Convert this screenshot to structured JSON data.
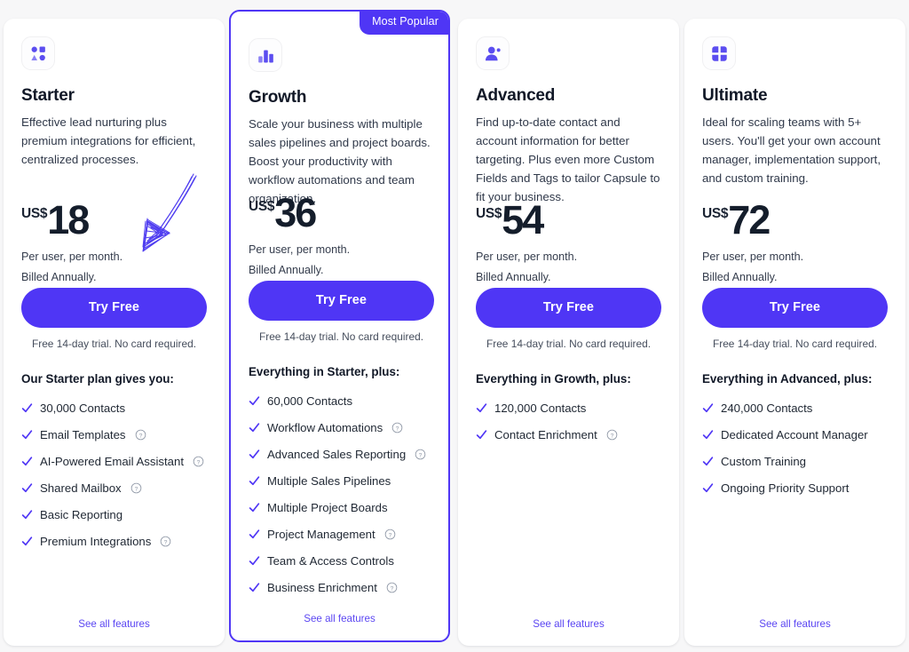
{
  "page": {
    "background": "#f7f7f8",
    "accent": "#4f36f5"
  },
  "annotation": {
    "type": "hand-drawn-arrow",
    "color": "#4f3df0",
    "points_to": "starter-try-free-button"
  },
  "plans": [
    {
      "id": "starter",
      "icon": "shapes-grid-icon",
      "name": "Starter",
      "description": "Effective lead nurturing plus premium integrations for efficient, centralized processes.",
      "badge": null,
      "currency": "US$",
      "price": "18",
      "price_note_1": "Per user, per month.",
      "price_note_2": "Billed Annually.",
      "cta_label": "Try Free",
      "cta_subtext": "Free 14-day trial. No card required.",
      "features_title": "Our Starter plan gives you:",
      "features": [
        {
          "label": "30,000 Contacts",
          "help": false
        },
        {
          "label": "Email Templates",
          "help": true
        },
        {
          "label": "AI-Powered Email Assistant",
          "help": true
        },
        {
          "label": "Shared Mailbox",
          "help": true
        },
        {
          "label": "Basic Reporting",
          "help": false
        },
        {
          "label": "Premium Integrations",
          "help": true
        }
      ],
      "see_all_label": "See all features"
    },
    {
      "id": "growth",
      "icon": "bar-chart-icon",
      "name": "Growth",
      "description": "Scale your business with multiple sales pipelines and project boards. Boost your productivity with workflow automations and team organization.",
      "badge": "Most Popular",
      "currency": "US$",
      "price": "36",
      "price_note_1": "Per user, per month.",
      "price_note_2": "Billed Annually.",
      "cta_label": "Try Free",
      "cta_subtext": "Free 14-day trial. No card required.",
      "features_title": "Everything in Starter, plus:",
      "features": [
        {
          "label": "60,000 Contacts",
          "help": false
        },
        {
          "label": "Workflow Automations",
          "help": true
        },
        {
          "label": "Advanced Sales Reporting",
          "help": true
        },
        {
          "label": "Multiple Sales Pipelines",
          "help": false
        },
        {
          "label": "Multiple Project Boards",
          "help": false
        },
        {
          "label": "Project Management",
          "help": true
        },
        {
          "label": "Team & Access Controls",
          "help": false
        },
        {
          "label": "Business Enrichment",
          "help": true
        }
      ],
      "see_all_label": "See all features"
    },
    {
      "id": "advanced",
      "icon": "user-plus-icon",
      "name": "Advanced",
      "description": "Find up-to-date contact and account information for better targeting. Plus even more Custom Fields and Tags to tailor Capsule to fit your business.",
      "badge": null,
      "currency": "US$",
      "price": "54",
      "price_note_1": "Per user, per month.",
      "price_note_2": "Billed Annually.",
      "cta_label": "Try Free",
      "cta_subtext": "Free 14-day trial. No card required.",
      "features_title": "Everything in Growth, plus:",
      "features": [
        {
          "label": "120,000 Contacts",
          "help": false
        },
        {
          "label": "Contact Enrichment",
          "help": true
        }
      ],
      "see_all_label": "See all features"
    },
    {
      "id": "ultimate",
      "icon": "four-petal-icon",
      "name": "Ultimate",
      "description": "Ideal for scaling teams with 5+ users. You'll get your own account manager, implementation support, and custom training.",
      "badge": null,
      "currency": "US$",
      "price": "72",
      "price_note_1": "Per user, per month.",
      "price_note_2": "Billed Annually.",
      "cta_label": "Try Free",
      "cta_subtext": "Free 14-day trial. No card required.",
      "features_title": "Everything in Advanced, plus:",
      "features": [
        {
          "label": "240,000 Contacts",
          "help": false
        },
        {
          "label": "Dedicated Account Manager",
          "help": false
        },
        {
          "label": "Custom Training",
          "help": false
        },
        {
          "label": "Ongoing Priority Support",
          "help": false
        }
      ],
      "see_all_label": "See all features"
    }
  ]
}
